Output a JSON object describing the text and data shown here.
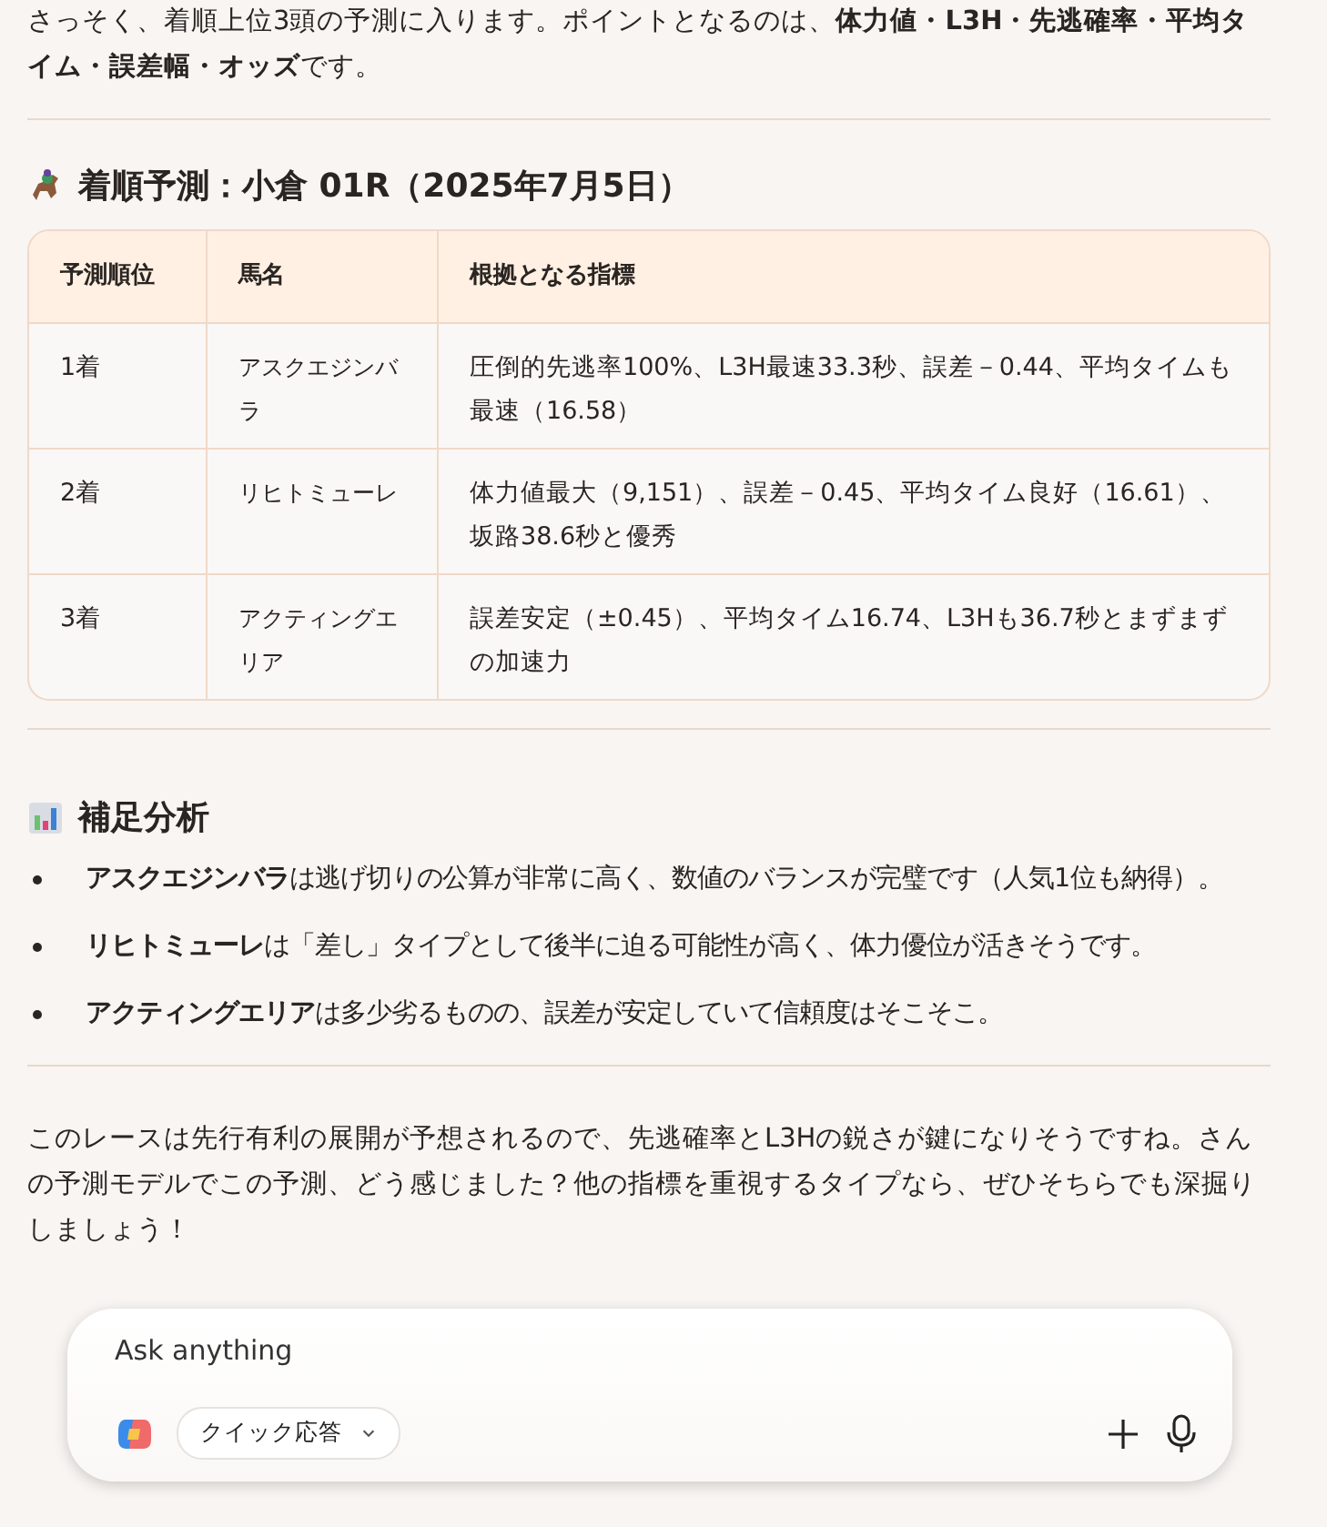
{
  "intro": "さっそく、着順上位3頭の予測に入ります。ポイントとなるのは、**体力値・L3H・先逃確率・平均タイム・誤差幅・オッズ**です。",
  "prediction": {
    "title": "着順予測：小倉 01R（2025年7月5日）",
    "columns": [
      "予測順位",
      "馬名",
      "根拠となる指標"
    ],
    "rows": [
      [
        "1着",
        "アスクエジンバラ",
        "圧倒的先逃率100%、L3H最速33.3秒、誤差－0.44、平均タイムも最速（16.58）"
      ],
      [
        "2着",
        "リヒトミューレ",
        "体力値最大（9,151）、誤差－0.45、平均タイム良好（16.61）、坂路38.6秒と優秀"
      ],
      [
        "3着",
        "アクティングエリア",
        "誤差安定（±0.45）、平均タイム16.74、L3Hも36.7秒とまずまずの加速力"
      ]
    ]
  },
  "analysis": {
    "title": "補足分析",
    "items": [
      "**アスクエジンバラ**は逃げ切りの公算が非常に高く、数値のバランスが完璧です（人気1位も納得）。",
      "**リヒトミューレ**は「差し」タイプとして後半に迫る可能性が高く、体力優位が活きそうです。",
      "**アクティングエリア**は多少劣るものの、誤差が安定していて信頼度はそこそこ。"
    ]
  },
  "closing": "このレースは先行有利の展開が予想されるので、先逃確率とL3Hの鋭さが鍵になりそうですね。さんの予測モデルでこの予測、どう感じました？他の指標を重視するタイプなら、ぜひそちらでも深掘りしましょう！",
  "composer": {
    "placeholder": "Ask anything",
    "mode": "クイック応答"
  }
}
